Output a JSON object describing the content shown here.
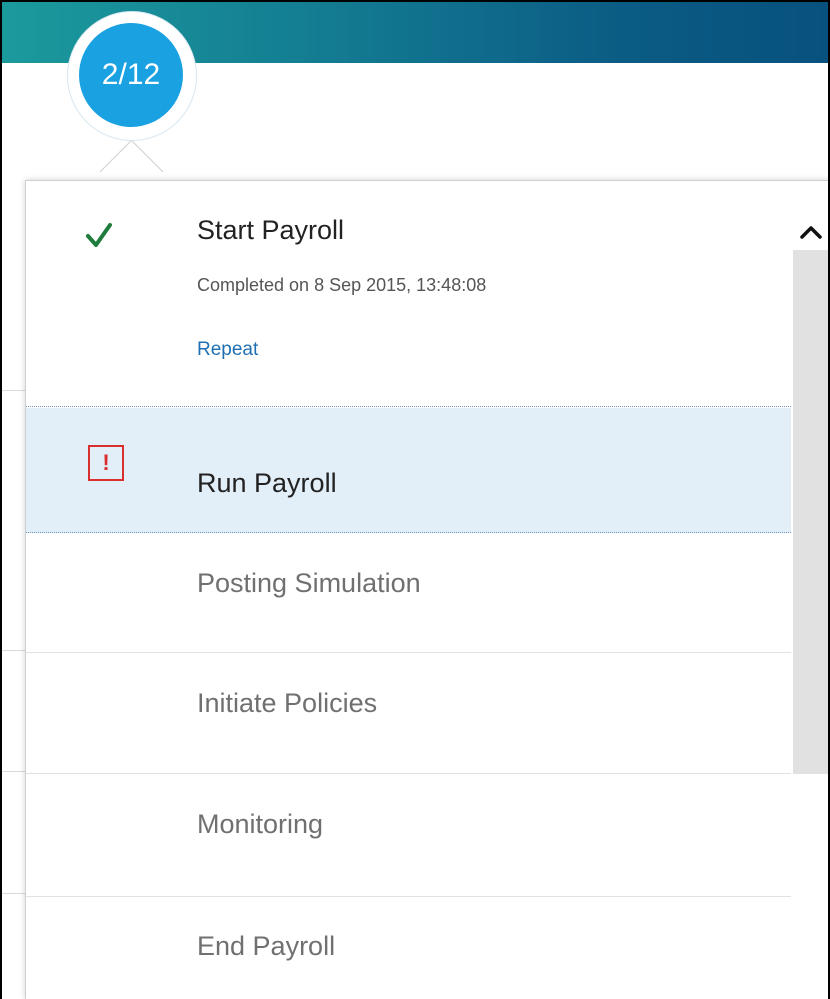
{
  "header": {
    "step_counter": "2/12",
    "accent_color": "#1aa1e2"
  },
  "steps": [
    {
      "title": "Start Payroll",
      "status": "completed",
      "status_icon": "check-icon",
      "subtitle": "Completed on 8 Sep 2015, 13:48:08",
      "action_label": "Repeat"
    },
    {
      "title": "Run Payroll",
      "status": "error",
      "status_icon": "error-icon",
      "icon_glyph": "!",
      "selected": true
    },
    {
      "title": "Posting Simulation",
      "status": "pending"
    },
    {
      "title": "Initiate Policies",
      "status": "pending"
    },
    {
      "title": "Monitoring",
      "status": "pending"
    },
    {
      "title": "End Payroll",
      "status": "pending"
    }
  ],
  "colors": {
    "completed": "#1e7d3c",
    "error": "#d9302e",
    "selected_row": "#e3eff8",
    "link": "#1f6fb2"
  },
  "scrollbar": {
    "up_icon": "chevron-up-icon"
  }
}
